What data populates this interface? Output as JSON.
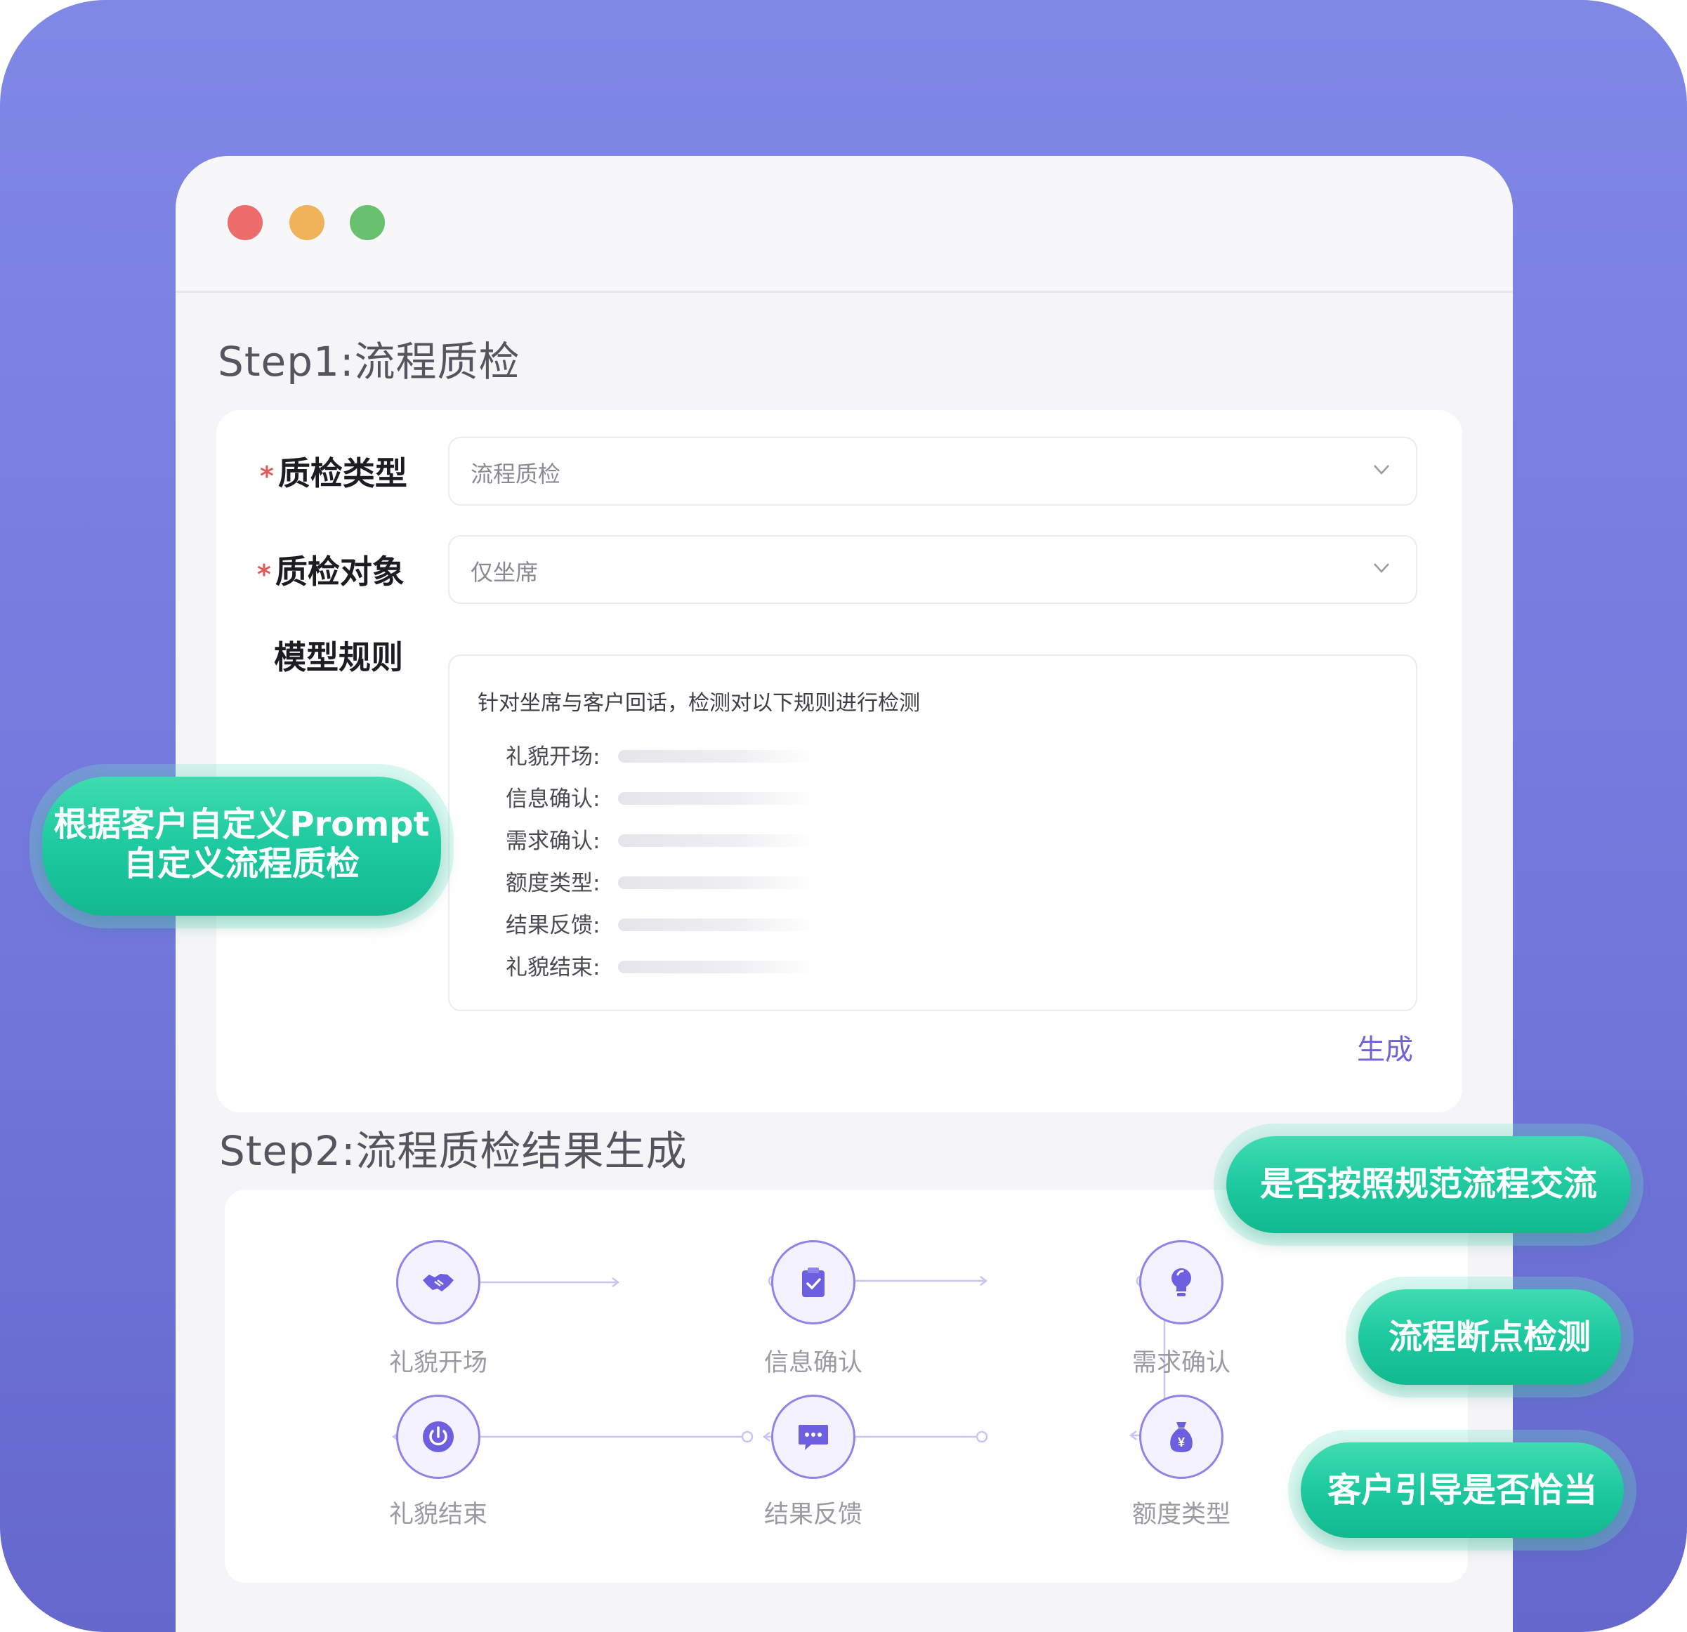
{
  "window": {
    "traffic_lights": [
      "close",
      "minimize",
      "maximize"
    ]
  },
  "step1": {
    "title": "Step1:流程质检",
    "fields": {
      "type_label": "质检类型",
      "type_value": "流程质检",
      "object_label": "质检对象",
      "object_value": "仅坐席",
      "rules_label": "模型规则",
      "required_mark": "*"
    },
    "rules": {
      "intro": "针对坐席与客户回话，检测对以下规则进行检测",
      "items": [
        "礼貌开场:",
        "信息确认:",
        "需求确认:",
        "额度类型:",
        "结果反馈:",
        "礼貌结束:"
      ]
    },
    "generate_label": "生成"
  },
  "step2": {
    "title": "Step2:流程质检结果生成",
    "flow": [
      {
        "label": "礼貌开场",
        "icon": "handshake-icon"
      },
      {
        "label": "信息确认",
        "icon": "clipboard-check-icon"
      },
      {
        "label": "需求确认",
        "icon": "lightbulb-icon"
      },
      {
        "label": "额度类型",
        "icon": "money-bag-icon"
      },
      {
        "label": "结果反馈",
        "icon": "chat-bubble-icon"
      },
      {
        "label": "礼貌结束",
        "icon": "power-icon"
      }
    ]
  },
  "callouts": {
    "prompt_line1": "根据客户自定义Prompt",
    "prompt_line2": "自定义流程质检",
    "standard_flow": "是否按照规范流程交流",
    "breakpoint": "流程断点检测",
    "guidance": "客户引导是否恰当"
  },
  "colors": {
    "accent": "#6e63d8",
    "teal": "#1ec9a0",
    "background": "#7a80e2",
    "required": "#e05b5b"
  }
}
